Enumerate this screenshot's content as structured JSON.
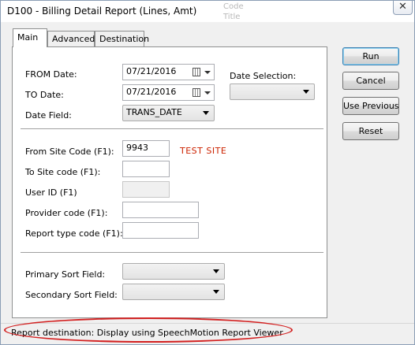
{
  "window": {
    "title": "D100 - Billing Detail Report (Lines, Amt)",
    "close_glyph": "✕",
    "ghost_text": [
      "Code",
      "Title"
    ]
  },
  "tabs": [
    {
      "label": "Main",
      "active": true
    },
    {
      "label": "Advanced",
      "active": false
    },
    {
      "label": "Destination",
      "active": false
    }
  ],
  "dates": {
    "from_label": "FROM Date:",
    "from_value": "07/21/2016",
    "to_label": "TO Date:",
    "to_value": "07/21/2016",
    "field_label": "Date Field:",
    "field_value": "TRANS_DATE",
    "selection_label": "Date Selection:",
    "selection_value": ""
  },
  "codes": {
    "from_site_label": "From Site Code (F1):",
    "from_site_value": "9943",
    "site_name": "TEST SITE",
    "to_site_label": "To Site code (F1):",
    "to_site_value": "",
    "user_id_label": "User ID (F1)",
    "user_id_value": "",
    "provider_label": "Provider code (F1):",
    "provider_value": "",
    "report_type_label": "Report type code (F1):",
    "report_type_value": ""
  },
  "sort": {
    "primary_label": "Primary Sort Field:",
    "primary_value": "",
    "secondary_label": "Secondary Sort Field:",
    "secondary_value": ""
  },
  "buttons": {
    "run": "Run",
    "cancel": "Cancel",
    "use_previous": "Use Previous",
    "reset": "Reset"
  },
  "status": {
    "text": "Report destination: Display using SpeechMotion Report Viewer"
  },
  "colors": {
    "site_name": "#cc2200",
    "highlight_ring": "#d32020",
    "default_button_border": "#3c7fb1"
  }
}
